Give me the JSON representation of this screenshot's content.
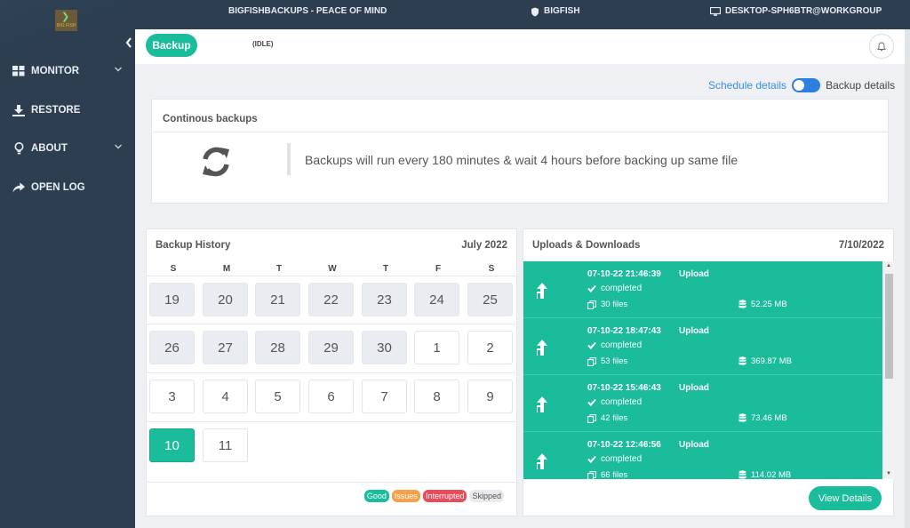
{
  "topbar": {
    "app_title": "BIGFISHBACKUPS - PEACE OF MIND",
    "account": "BIGFISH",
    "machine": "DESKTOP-SPH6BTR@WORKGROUP",
    "logo_text": "BIG FISH"
  },
  "sidebar": {
    "items": [
      {
        "label": "MONITOR",
        "icon": "grid-icon"
      },
      {
        "label": "RESTORE",
        "icon": "download-icon"
      },
      {
        "label": "ABOUT",
        "icon": "lightbulb-icon"
      },
      {
        "label": "OPEN LOG",
        "icon": "share-arrow-icon"
      }
    ]
  },
  "header": {
    "tab_label": "Backup",
    "status": "(IDLE)"
  },
  "toggle": {
    "left_label": "Schedule details",
    "right_label": "Backup details"
  },
  "continuous": {
    "title": "Continous backups",
    "message": "Backups will run every 180 minutes & wait 4 hours before backing up same file"
  },
  "history": {
    "title": "Backup History",
    "month": "July 2022",
    "weekdays": [
      "S",
      "M",
      "T",
      "W",
      "T",
      "F",
      "S"
    ],
    "rows": [
      [
        "19",
        "20",
        "21",
        "22",
        "23",
        "24",
        "25"
      ],
      [
        "26",
        "27",
        "28",
        "29",
        "30",
        "1",
        "2"
      ],
      [
        "3",
        "4",
        "5",
        "6",
        "7",
        "8",
        "9"
      ],
      [
        "10",
        "11"
      ]
    ],
    "legend": [
      "Good",
      "Issues",
      "Interrupted",
      "Skipped"
    ]
  },
  "colors": {
    "accent": "#1abc9c",
    "good": "#1abc9c",
    "issues": "#f5a14a",
    "interrupted": "#e74c5c",
    "skipped": "#e8eaed",
    "sidebar": "#2c3e50"
  },
  "uploads": {
    "title": "Uploads & Downloads",
    "date": "7/10/2022",
    "items": [
      {
        "timestamp": "07-10-22 21:46:39",
        "direction": "Upload",
        "status": "completed",
        "files": "30 files",
        "size": "52.25 MB"
      },
      {
        "timestamp": "07-10-22 18:47:43",
        "direction": "Upload",
        "status": "completed",
        "files": "53 files",
        "size": "369.87 MB"
      },
      {
        "timestamp": "07-10-22 15:46:43",
        "direction": "Upload",
        "status": "completed",
        "files": "42 files",
        "size": "73.46 MB"
      },
      {
        "timestamp": "07-10-22 12:46:56",
        "direction": "Upload",
        "status": "completed",
        "files": "66 files",
        "size": "114.02 MB"
      }
    ],
    "view_button": "View Details"
  }
}
